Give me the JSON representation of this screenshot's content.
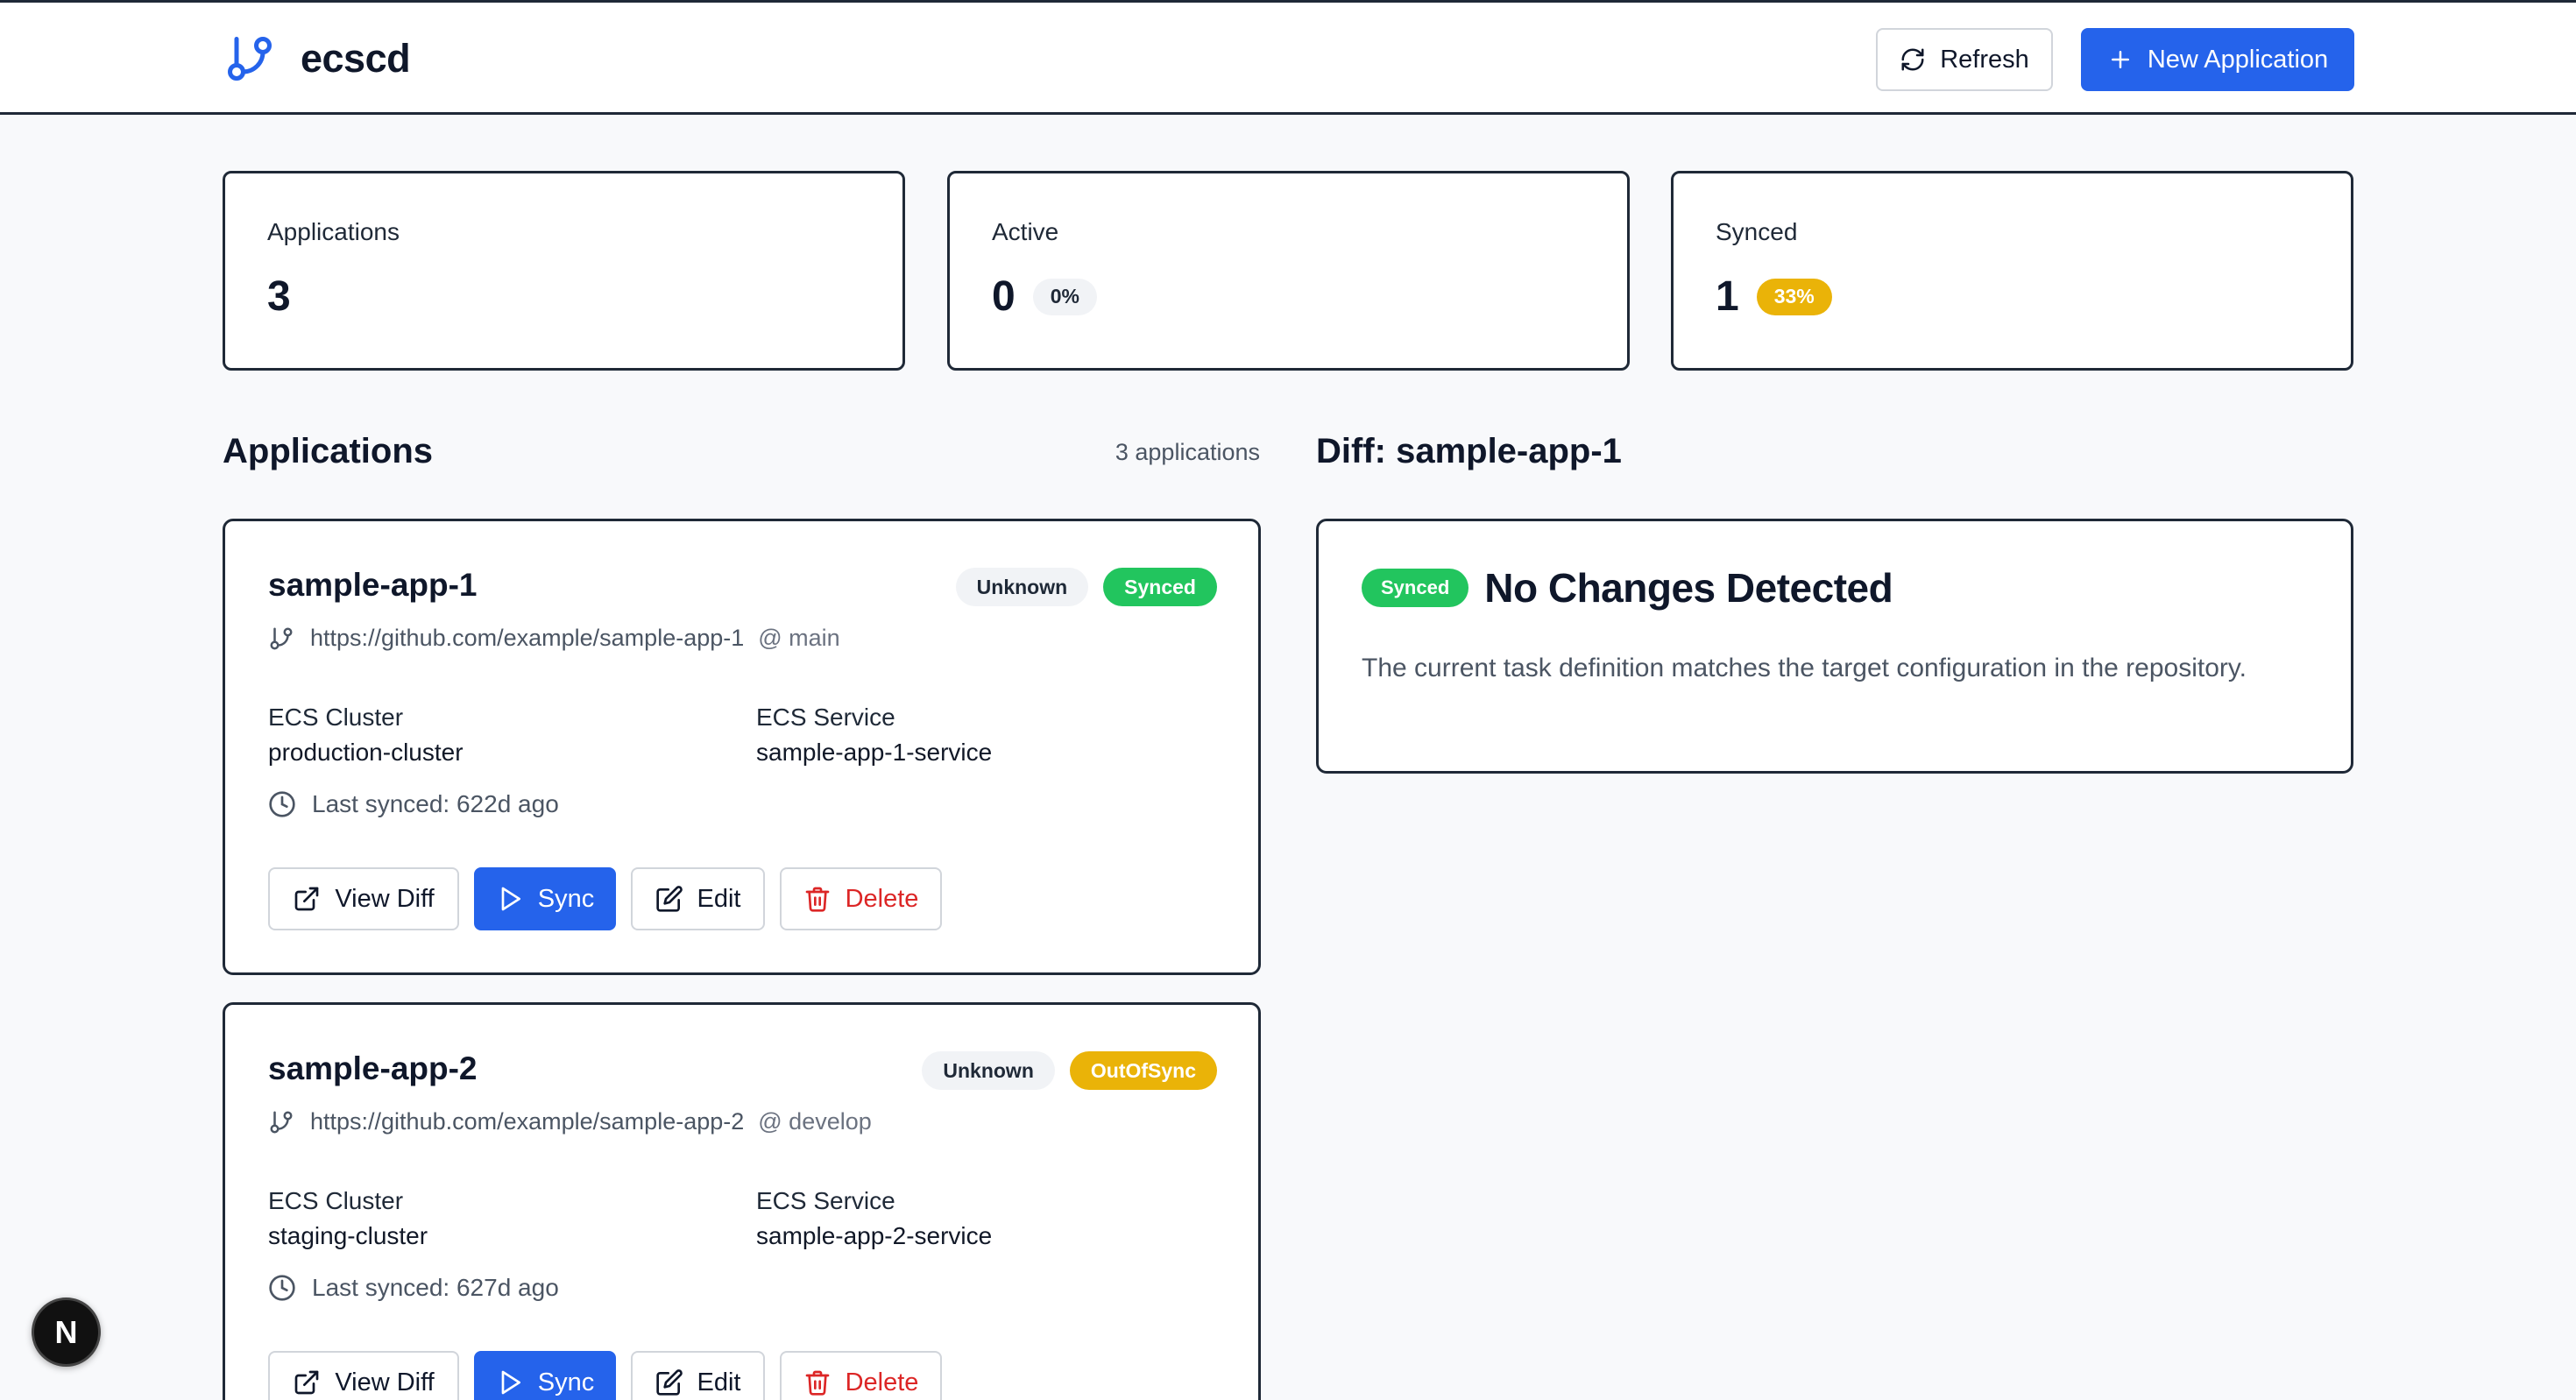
{
  "header": {
    "brand": "ecscd",
    "refresh_label": "Refresh",
    "new_app_label": "New Application"
  },
  "stats": [
    {
      "label": "Applications",
      "value": "3",
      "badge": ""
    },
    {
      "label": "Active",
      "value": "0",
      "badge": "0%"
    },
    {
      "label": "Synced",
      "value": "1",
      "badge": "33%"
    }
  ],
  "applications_section": {
    "title": "Applications",
    "count": "3 applications"
  },
  "apps": [
    {
      "name": "sample-app-1",
      "health": "Unknown",
      "sync": "Synced",
      "repo": "https://github.com/example/sample-app-1",
      "branch": "@ main",
      "cluster_label": "ECS Cluster",
      "cluster": "production-cluster",
      "service_label": "ECS Service",
      "service": "sample-app-1-service",
      "last_synced": "Last synced: 622d ago"
    },
    {
      "name": "sample-app-2",
      "health": "Unknown",
      "sync": "OutOfSync",
      "repo": "https://github.com/example/sample-app-2",
      "branch": "@ develop",
      "cluster_label": "ECS Cluster",
      "cluster": "staging-cluster",
      "service_label": "ECS Service",
      "service": "sample-app-2-service",
      "last_synced": "Last synced: 627d ago"
    }
  ],
  "actions": {
    "view_diff": "View Diff",
    "sync": "Sync",
    "edit": "Edit",
    "delete": "Delete"
  },
  "diff": {
    "title": "Diff: sample-app-1",
    "status": "Synced",
    "heading": "No Changes Detected",
    "text": "The current task definition matches the target configuration in the repository."
  },
  "dev_badge": "N",
  "colors": {
    "primary": "#2563eb",
    "synced": "#22c55e",
    "out_of_sync": "#eab308",
    "danger": "#dc2626"
  }
}
